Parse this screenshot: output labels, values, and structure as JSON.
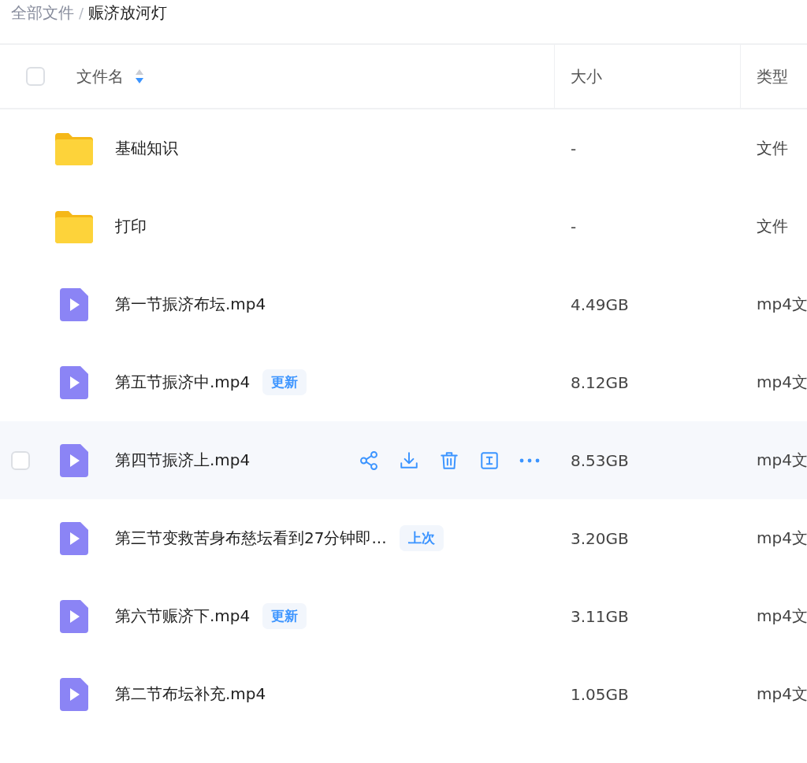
{
  "breadcrumb": {
    "root": "全部文件",
    "separator": "/",
    "current": "赈济放河灯"
  },
  "table": {
    "select_all": {
      "checked": false
    },
    "columns": [
      {
        "label": "文件名",
        "sort_descending": true
      },
      {
        "label": "大小"
      },
      {
        "label": "类型"
      }
    ],
    "rows": [
      {
        "kind": "folder",
        "name": "基础知识",
        "size": "-",
        "type": "文件",
        "hovered": false
      },
      {
        "kind": "folder",
        "name": "打印",
        "size": "-",
        "type": "文件",
        "hovered": false
      },
      {
        "kind": "video",
        "name": "第一节振济布坛.mp4",
        "size": "4.49GB",
        "type": "mp4文",
        "hovered": false
      },
      {
        "kind": "video",
        "name": "第五节振济中.mp4",
        "tag": "更新",
        "size": "8.12GB",
        "type": "mp4文",
        "hovered": false
      },
      {
        "kind": "video",
        "name": "第四节振济上.mp4",
        "size": "8.53GB",
        "type": "mp4文",
        "hovered": true
      },
      {
        "kind": "video",
        "name": "第三节变救苦身布慈坛看到27分钟即...",
        "tag": "上次",
        "size": "3.20GB",
        "type": "mp4文",
        "hovered": false
      },
      {
        "kind": "video",
        "name": "第六节赈济下.mp4",
        "tag": "更新",
        "size": "3.11GB",
        "type": "mp4文",
        "hovered": false
      },
      {
        "kind": "video",
        "name": "第二节布坛补充.mp4",
        "size": "1.05GB",
        "type": "mp4文",
        "hovered": false
      }
    ]
  }
}
